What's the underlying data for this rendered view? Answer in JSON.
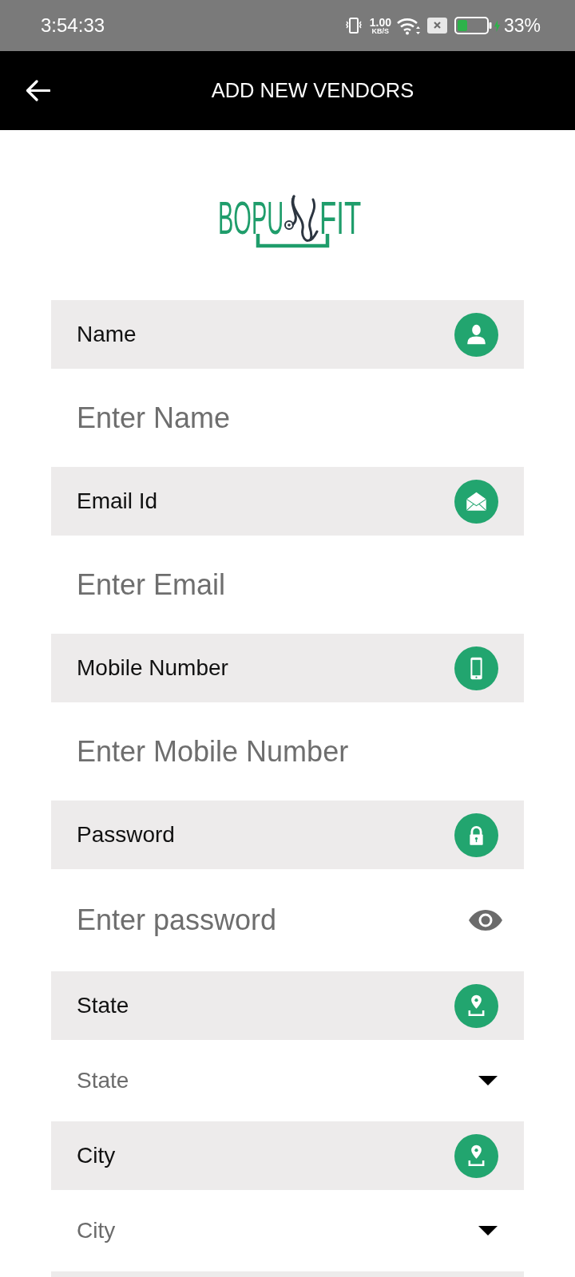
{
  "status_bar": {
    "time": "3:54:33",
    "network_speed": "1.00",
    "network_speed_unit": "KB/S",
    "battery_percent": "33%"
  },
  "app_bar": {
    "title": "ADD NEW VENDORS"
  },
  "logo": {
    "text_left": "BOPU",
    "text_right": "FIT"
  },
  "fields": [
    {
      "kind": "text",
      "label": "Name",
      "placeholder": "Enter Name"
    },
    {
      "kind": "email",
      "label": "Email Id",
      "placeholder": "Enter Email"
    },
    {
      "kind": "phone",
      "label": "Mobile Number",
      "placeholder": "Enter Mobile Number"
    },
    {
      "kind": "password",
      "label": "Password",
      "placeholder": "Enter password"
    },
    {
      "kind": "select",
      "label": "State",
      "placeholder": "State"
    },
    {
      "kind": "select",
      "label": "City",
      "placeholder": "City"
    }
  ]
}
